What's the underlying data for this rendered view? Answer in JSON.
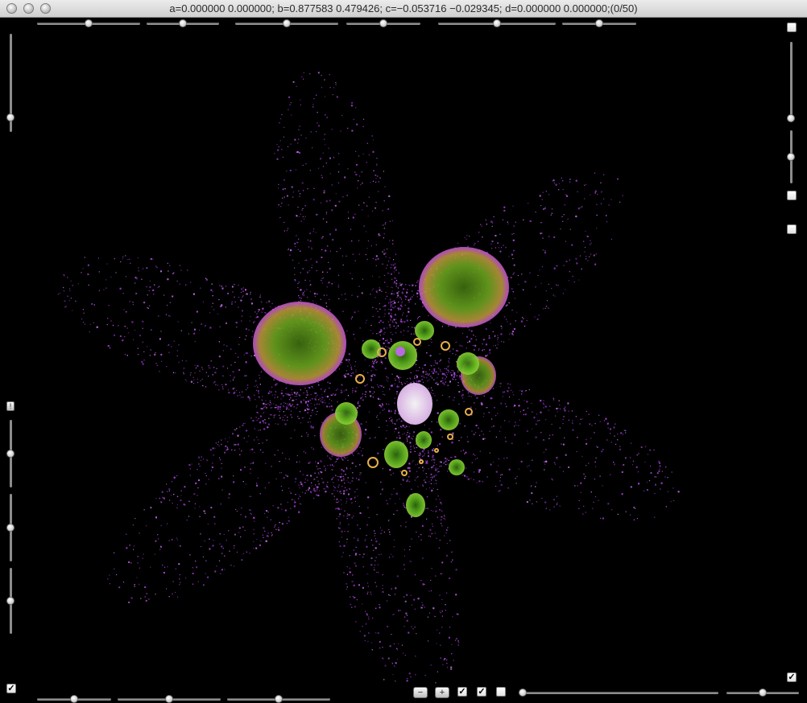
{
  "window": {
    "title": "a=0.000000 0.000000; b=0.877583 0.479426; c=−0.053716 −0.029345; d=0.000000 0.000000;(0/50)"
  },
  "top_sliders": [
    {
      "name": "top-slider-1",
      "value": 0.5
    },
    {
      "name": "top-slider-2",
      "value": 0.5
    },
    {
      "name": "top-slider-3",
      "value": 0.5
    },
    {
      "name": "top-slider-4",
      "value": 0.5
    },
    {
      "name": "top-slider-5",
      "value": 0.5
    },
    {
      "name": "top-slider-6",
      "value": 0.5
    }
  ],
  "left_sliders": [
    {
      "name": "left-slider-1",
      "value": 0.5
    },
    {
      "name": "left-slider-2",
      "value": 0.5
    },
    {
      "name": "left-slider-3",
      "value": 0.5
    },
    {
      "name": "left-slider-4",
      "value": 0.5
    }
  ],
  "right_sliders": [
    {
      "name": "right-slider-1",
      "value": 1.0
    },
    {
      "name": "right-slider-2",
      "value": 0.5
    }
  ],
  "bottom_sliders": [
    {
      "name": "bottom-slider-1",
      "value": 0.5
    },
    {
      "name": "bottom-slider-2",
      "value": 0.5
    },
    {
      "name": "bottom-slider-3",
      "value": 0.5
    },
    {
      "name": "bottom-slider-4",
      "value": 0.0
    },
    {
      "name": "bottom-slider-5",
      "value": 0.5
    }
  ],
  "buttons": {
    "zoom_out": "−",
    "zoom_in": "+",
    "left_small": "!"
  },
  "checkboxes": {
    "bottom_left": true,
    "bottom_1": true,
    "bottom_2": true,
    "bottom_3": false,
    "bottom_right": true,
    "right_1": false,
    "right_2": false,
    "right_3": false
  },
  "colors": {
    "background": "#000000",
    "fractal_purple": "#a23fd6",
    "fractal_green": "#5aa81e",
    "fractal_yellow": "#e8b04a",
    "fractal_pink": "#e6c8f0"
  }
}
